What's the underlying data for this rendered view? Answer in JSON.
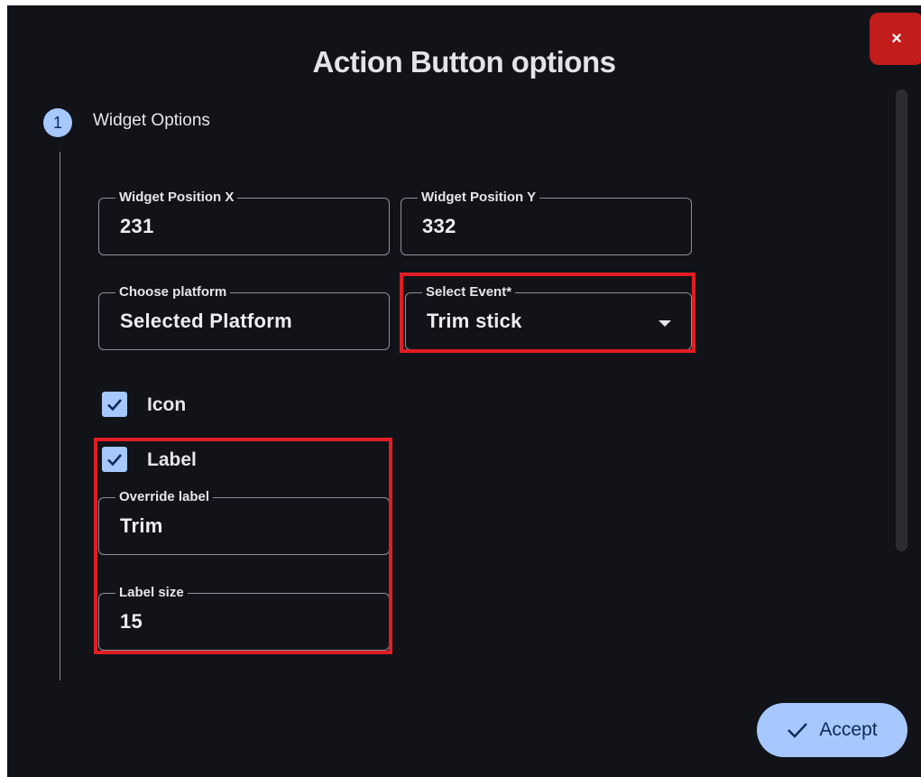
{
  "dialog": {
    "title": "Action Button options",
    "close_label": "×"
  },
  "step": {
    "number": "1",
    "title": "Widget Options"
  },
  "fields": {
    "position_x": {
      "label": "Widget Position X",
      "value": "231"
    },
    "position_y": {
      "label": "Widget Position Y",
      "value": "332"
    },
    "platform": {
      "label": "Choose platform",
      "value": "Selected Platform"
    },
    "event": {
      "label": "Select Event*",
      "value": "Trim stick"
    },
    "override_label": {
      "label": "Override label",
      "value": "Trim"
    },
    "label_size": {
      "label": "Label size",
      "value": "15"
    }
  },
  "checkboxes": {
    "icon": {
      "label": "Icon",
      "checked": true
    },
    "label": {
      "label": "Label",
      "checked": true
    }
  },
  "actions": {
    "accept_label": "Accept"
  },
  "icons": {
    "close": "close-icon",
    "check": "check-icon",
    "dropdown": "chevron-down-icon"
  },
  "colors": {
    "background": "#111318",
    "accent": "#a6c8ff",
    "close": "#c21c1c",
    "highlight": "#e01d24"
  }
}
